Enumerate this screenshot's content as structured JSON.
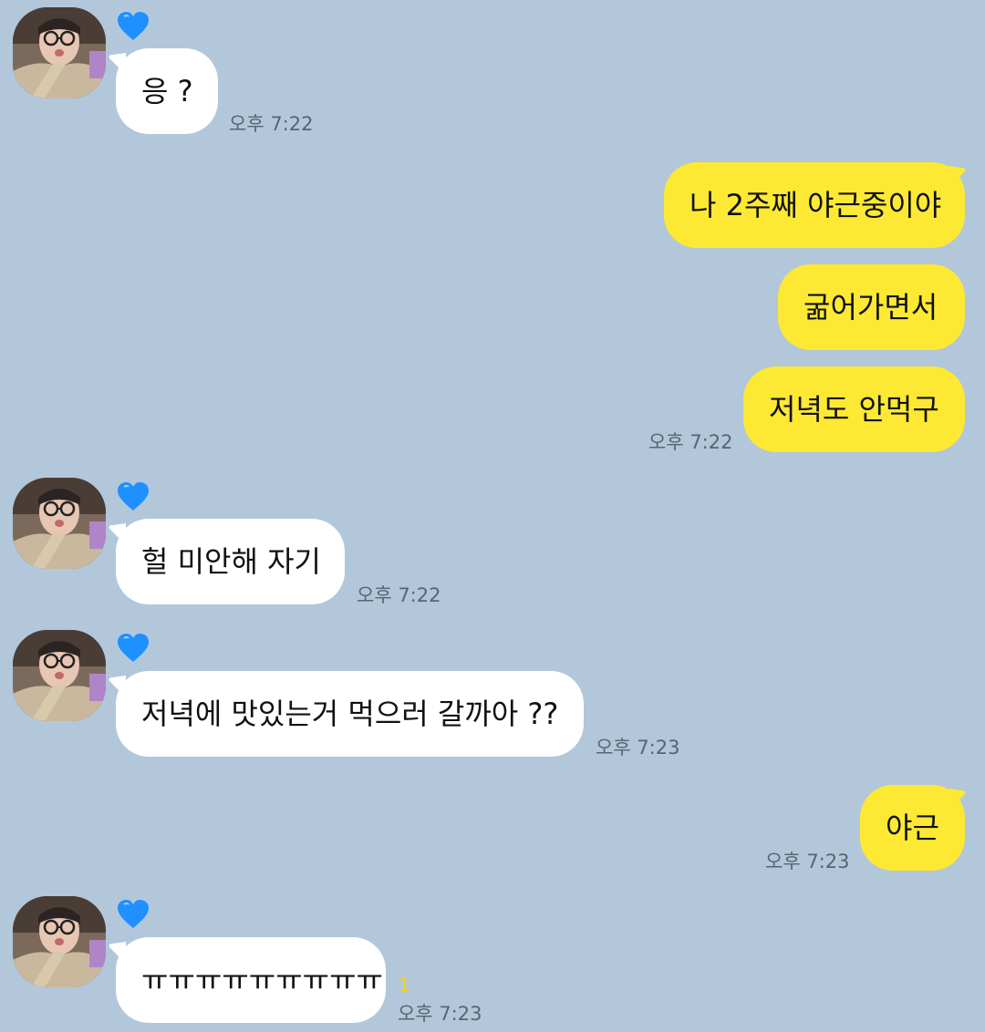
{
  "messages": [
    {
      "direction": "in",
      "text": "응 ?",
      "time": "오후 7:22",
      "sender_icon": "blue-heart-icon"
    },
    {
      "direction": "out",
      "text": "나 2주째 야근중이야"
    },
    {
      "direction": "out",
      "text": "굶어가면서"
    },
    {
      "direction": "out",
      "text": "저녁도 안먹구",
      "time": "오후 7:22"
    },
    {
      "direction": "in",
      "text": "헐 미안해 자기",
      "time": "오후 7:22",
      "sender_icon": "blue-heart-icon"
    },
    {
      "direction": "in",
      "text": "저녁에 맛있는거 먹으러 갈까아 ??",
      "time": "오후 7:23",
      "sender_icon": "blue-heart-icon"
    },
    {
      "direction": "out",
      "text": "야근",
      "time": "오후 7:23"
    },
    {
      "direction": "in",
      "text": "ㅠㅠㅠㅠㅠㅠㅠㅠㅠ",
      "time": "오후 7:23",
      "unread": "1",
      "sender_icon": "blue-heart-icon"
    }
  ],
  "colors": {
    "background": "#b2c7da",
    "incoming_bubble": "#ffffff",
    "outgoing_bubble": "#fde934",
    "sender_heart": "#1e90ff",
    "unread_count": "#f5d400"
  }
}
